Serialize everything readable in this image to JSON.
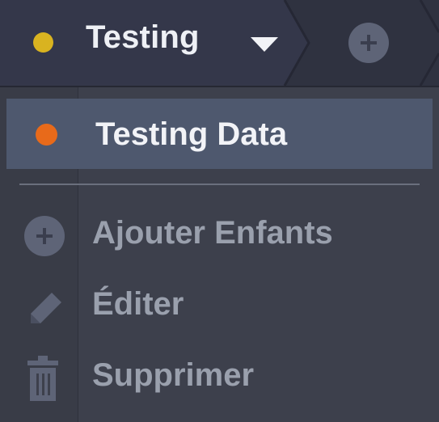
{
  "breadcrumb": {
    "current": {
      "label": "Testing",
      "status_color": "#d9b320"
    },
    "add_icon": "plus-circle-icon",
    "caret_icon": "caret-down-icon"
  },
  "dropdown": {
    "selected_item": {
      "label": "Testing Data",
      "status_color": "#e86a1a"
    },
    "actions": [
      {
        "label": "Ajouter Enfants",
        "icon": "plus-circle-icon"
      },
      {
        "label": "Éditer",
        "icon": "pencil-icon"
      },
      {
        "label": "Supprimer",
        "icon": "trash-icon"
      }
    ]
  },
  "colors": {
    "topbar_bg": "#2f3240",
    "menu_bg": "#3d404c",
    "selected_bg": "#4e586e",
    "text_primary": "#eef0f5",
    "text_muted": "#9aa0ad"
  }
}
